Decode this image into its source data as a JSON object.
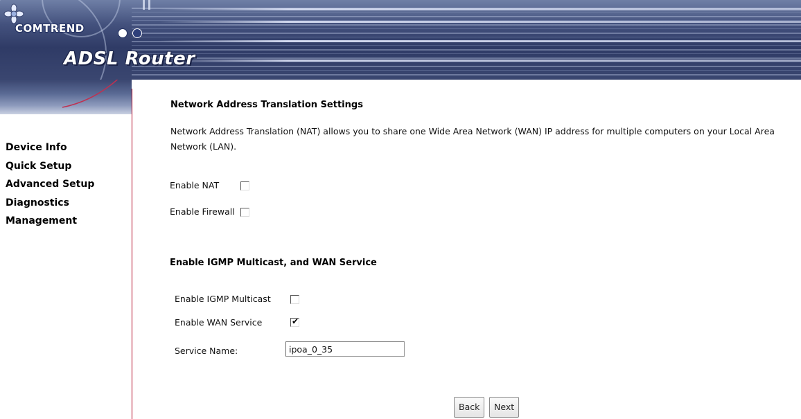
{
  "header": {
    "brand": "COMTREND",
    "product": "ADSL Router",
    "colors": {
      "banner": "#3a4670",
      "sidebar_border": "#b00020",
      "logo_dot_1": "#ffffff",
      "logo_dot_2": "#2e3f7a"
    }
  },
  "sidebar": {
    "items": [
      {
        "label": "Device Info"
      },
      {
        "label": "Quick Setup"
      },
      {
        "label": "Advanced Setup"
      },
      {
        "label": "Diagnostics"
      },
      {
        "label": "Management"
      }
    ]
  },
  "nat": {
    "title": "Network Address Translation Settings",
    "description": "Network Address Translation (NAT) allows you to share one Wide Area Network (WAN) IP address for multiple computers on your Local Area Network (LAN).",
    "enable_nat_label": "Enable NAT",
    "enable_nat_checked": false,
    "enable_firewall_label": "Enable Firewall",
    "enable_firewall_checked": false
  },
  "igmp": {
    "title": "Enable IGMP Multicast, and WAN Service",
    "enable_igmp_label": "Enable IGMP Multicast",
    "enable_igmp_checked": false,
    "enable_wan_label": "Enable WAN Service",
    "enable_wan_checked": true,
    "service_name_label": "Service Name:",
    "service_name_value": "ipoa_0_35"
  },
  "buttons": {
    "back": "Back",
    "next": "Next"
  },
  "icons": {
    "check_glyph": "✔"
  }
}
